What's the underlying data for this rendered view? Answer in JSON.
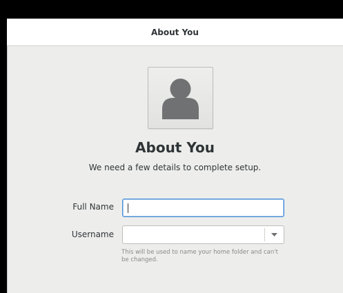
{
  "header": {
    "title": "About You"
  },
  "avatar": {
    "icon": "avatar-placeholder-icon"
  },
  "main": {
    "title": "About You",
    "subtitle": "We need a few details to complete setup."
  },
  "form": {
    "full_name": {
      "label": "Full Name",
      "value": ""
    },
    "username": {
      "label": "Username",
      "value": "",
      "hint": "This will be used to name your home folder and can't be changed."
    }
  },
  "colors": {
    "background": "#edeeec",
    "header": "#ffffff",
    "focus_border": "#4a90d9",
    "text": "#2e3436",
    "hint_text": "#888a85"
  }
}
